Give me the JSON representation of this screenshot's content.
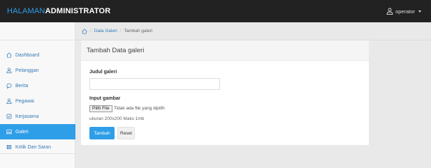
{
  "header": {
    "brand_part1": "HALAMAN",
    "brand_part2": "ADMINISTRATOR",
    "user_label": "operator"
  },
  "breadcrumb": {
    "items": [
      "Data Galeri",
      "Tambah galeri"
    ]
  },
  "sidebar": {
    "items": [
      {
        "label": "Dashboard",
        "icon": "home-icon"
      },
      {
        "label": "Pelanggan",
        "icon": "user-icon"
      },
      {
        "label": "Berita",
        "icon": "comment-icon"
      },
      {
        "label": "Pegawai",
        "icon": "user-icon"
      },
      {
        "label": "Kerjasama",
        "icon": "handshake-icon"
      },
      {
        "label": "Galeri",
        "icon": "image-icon",
        "active": true
      },
      {
        "label": "Kritik Dan Saran",
        "icon": "grid-icon"
      }
    ]
  },
  "form": {
    "title": "Tambah Data galeri",
    "judul_label": "Judul galeri",
    "judul_value": "",
    "gambar_label": "Input gambar",
    "file_button": "Pilih File",
    "file_status": "Tidak ada file yang dipilih",
    "size_hint": "ukuran 200x200 Maks 1mb",
    "submit_label": "Tambah",
    "reset_label": "Reset"
  },
  "colors": {
    "accent": "#2f9ee8",
    "navbar": "#222222"
  }
}
